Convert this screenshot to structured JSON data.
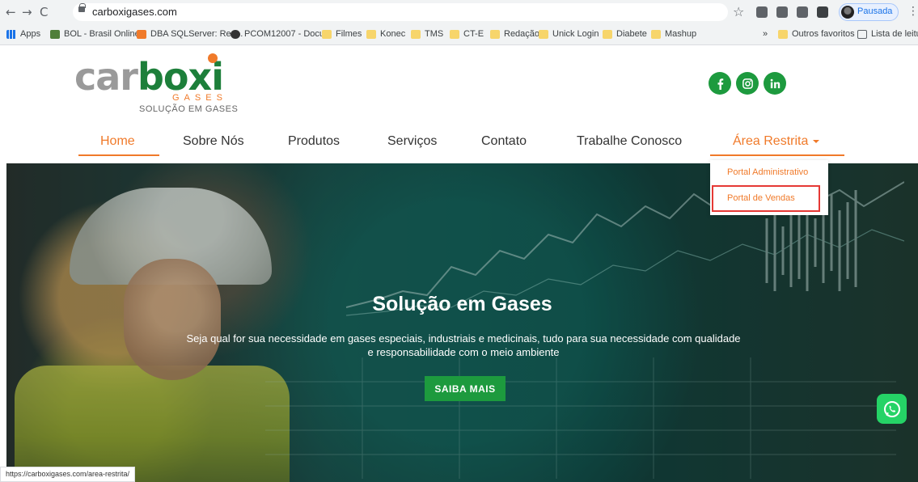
{
  "browser": {
    "url": "carboxigases.com",
    "profile_label": "Pausada",
    "back_glyph": "←",
    "forward_glyph": "→",
    "reload_glyph": "C",
    "star_glyph": "☆",
    "menu_glyph": "⋮"
  },
  "bookmarks": {
    "apps": "Apps",
    "items": [
      "BOL - Brasil Online",
      "DBA SQLServer: Rec...",
      "PCOM12007 - Docu...",
      "Filmes",
      "Konec",
      "TMS",
      "CT-E",
      "Redação",
      "Unick Login",
      "Diabete",
      "Mashup"
    ],
    "overflow": "»",
    "other": "Outros favoritos",
    "reading_list": "Lista de leitura"
  },
  "site": {
    "logo": {
      "part1": "car",
      "part2": "bo",
      "part3": "xi",
      "gases": "GASES",
      "tagline": "SOLUÇÃO EM GASES"
    },
    "social": {
      "icons": [
        "facebook-icon",
        "instagram-icon",
        "linkedin-icon"
      ]
    },
    "menu": {
      "home": "Home",
      "about": "Sobre Nós",
      "products": "Produtos",
      "services": "Serviços",
      "contact": "Contato",
      "careers": "Trabalhe Conosco",
      "restricted": "Área Restrita"
    },
    "dropdown": {
      "item1": "Portal Administrativo",
      "item2": "Portal de Vendas"
    },
    "hero": {
      "title": "Solução em Gases",
      "text": "Seja qual for sua necessidade em gases especiais, industriais e medicinais, tudo para sua necessidade com qualidade e responsabilidade com o meio ambiente",
      "cta": "SAIBA MAIS"
    },
    "status_url": "https://carboxigases.com/area-restrita/"
  },
  "colors": {
    "brand_green": "#1d9a3e",
    "brand_orange": "#f07a2a",
    "highlight_red": "#e53935",
    "logo_gray": "#9a9a9a"
  }
}
